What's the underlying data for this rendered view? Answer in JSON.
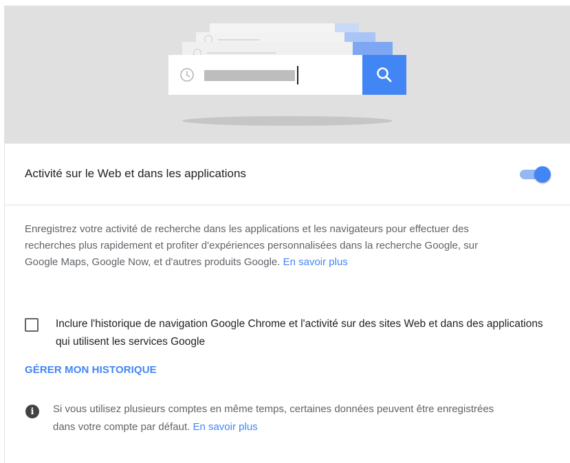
{
  "toggle": {
    "label": "Activité sur le Web et dans les applications",
    "state": "on",
    "accent_color": "#4285f4"
  },
  "description": {
    "text": "Enregistrez votre activité de recherche dans les applications et les navigateurs pour effectuer des recherches plus rapidement et profiter d'expériences personnalisées dans la recherche Google, sur Google Maps, Google Now, et d'autres produits Google. ",
    "link": "En savoir plus"
  },
  "checkbox": {
    "label": "Inclure l'historique de navigation Google Chrome et l'activité sur des sites Web et dans des applications qui utilisent les services Google",
    "checked": false
  },
  "manage_history": {
    "label": "GÉRER MON HISTORIQUE"
  },
  "info": {
    "icon": "info-icon",
    "text": "Si vous utilisez plusieurs comptes en même temps, certaines données peuvent être enregistrées dans votre compte par défaut. ",
    "link": "En savoir plus"
  },
  "illustration": {
    "icons": [
      "clock-icon",
      "search-icon"
    ]
  }
}
